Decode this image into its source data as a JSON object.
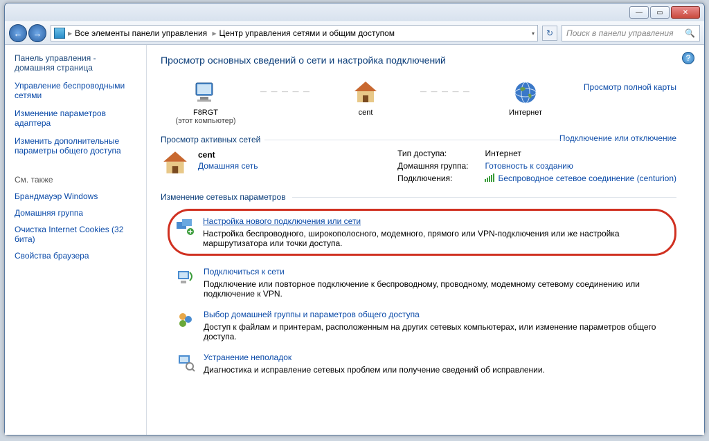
{
  "breadcrumb": {
    "level1": "Все элементы панели управления",
    "level2": "Центр управления сетями и общим доступом"
  },
  "search": {
    "placeholder": "Поиск в панели управления"
  },
  "sidebar": {
    "home": "Панель управления - домашняя страница",
    "links": [
      "Управление беспроводными сетями",
      "Изменение параметров адаптера",
      "Изменить дополнительные параметры общего доступа"
    ],
    "see_also_label": "См. также",
    "see_also": [
      "Брандмауэр Windows",
      "Домашняя группа",
      "Очистка Internet Cookies (32 бита)",
      "Свойства браузера"
    ]
  },
  "heading": "Просмотр основных сведений о сети и настройка подключений",
  "map": {
    "node1_label": "F8RGT",
    "node1_sub": "(этот компьютер)",
    "node2_label": "cent",
    "node3_label": "Интернет",
    "full_map_link": "Просмотр полной карты"
  },
  "active_section": "Просмотр активных сетей",
  "connect_link": "Подключение или отключение",
  "active_net": {
    "name": "cent",
    "type": "Домашняя сеть",
    "access_k": "Тип доступа:",
    "access_v": "Интернет",
    "homegroup_k": "Домашняя группа:",
    "homegroup_v": "Готовность к созданию",
    "conn_k": "Подключения:",
    "conn_v": "Беспроводное сетевое соединение (centurion)"
  },
  "change_section": "Изменение сетевых параметров",
  "tasks": [
    {
      "title": "Настройка нового подключения или сети",
      "desc": "Настройка беспроводного, широкополосного, модемного, прямого или VPN-подключения или же настройка маршрутизатора или точки доступа."
    },
    {
      "title": "Подключиться к сети",
      "desc": "Подключение или повторное подключение к беспроводному, проводному, модемному сетевому соединению или подключение к VPN."
    },
    {
      "title": "Выбор домашней группы и параметров общего доступа",
      "desc": "Доступ к файлам и принтерам, расположенным на других сетевых компьютерах, или изменение параметров общего доступа."
    },
    {
      "title": "Устранение неполадок",
      "desc": "Диагностика и исправление сетевых проблем или получение сведений об исправлении."
    }
  ]
}
